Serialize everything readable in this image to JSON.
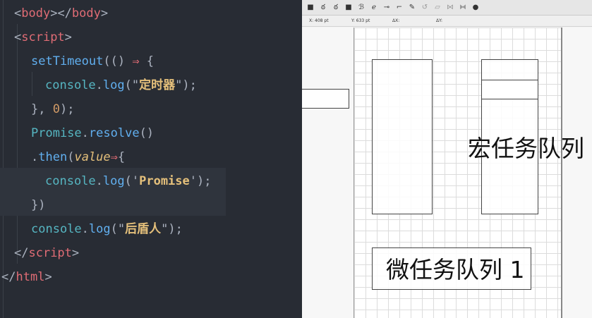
{
  "editor": {
    "lines": [
      {
        "tokens": [
          {
            "t": "<",
            "c": "punct"
          },
          {
            "t": "body",
            "c": "tag"
          },
          {
            "t": "></",
            "c": "punct"
          },
          {
            "t": "body",
            "c": "tag"
          },
          {
            "t": ">",
            "c": "punct"
          }
        ]
      },
      {
        "tokens": [
          {
            "t": "<",
            "c": "punct"
          },
          {
            "t": "script",
            "c": "tag"
          },
          {
            "t": ">",
            "c": "punct"
          }
        ]
      },
      {
        "tokens": [
          {
            "t": "setTimeout",
            "c": "fn"
          },
          {
            "t": "(() ",
            "c": "punct"
          },
          {
            "t": "⇒",
            "c": "arrow"
          },
          {
            "t": " {",
            "c": "punct"
          }
        ]
      },
      {
        "tokens": [
          {
            "t": "console",
            "c": "obj"
          },
          {
            "t": ".",
            "c": "punct"
          },
          {
            "t": "log",
            "c": "fn"
          },
          {
            "t": "(\"",
            "c": "punct"
          },
          {
            "t": "定时器",
            "c": "cn"
          },
          {
            "t": "\");",
            "c": "punct"
          }
        ]
      },
      {
        "tokens": [
          {
            "t": "}, ",
            "c": "punct"
          },
          {
            "t": "0",
            "c": "num"
          },
          {
            "t": ");",
            "c": "punct"
          }
        ]
      },
      {
        "tokens": [
          {
            "t": "Promise",
            "c": "obj"
          },
          {
            "t": ".",
            "c": "punct"
          },
          {
            "t": "resolve",
            "c": "fn"
          },
          {
            "t": "()",
            "c": "punct"
          }
        ]
      },
      {
        "tokens": [
          {
            "t": ".",
            "c": "punct"
          },
          {
            "t": "then",
            "c": "fn"
          },
          {
            "t": "(",
            "c": "punct"
          },
          {
            "t": "value",
            "c": "param"
          },
          {
            "t": "⇒",
            "c": "arrow"
          },
          {
            "t": "{",
            "c": "punct"
          }
        ]
      },
      {
        "tokens": [
          {
            "t": "console",
            "c": "obj"
          },
          {
            "t": ".",
            "c": "punct"
          },
          {
            "t": "log",
            "c": "fn"
          },
          {
            "t": "('",
            "c": "punct"
          },
          {
            "t": "Promise",
            "c": "cn"
          },
          {
            "t": "');",
            "c": "punct"
          }
        ]
      },
      {
        "tokens": [
          {
            "t": "})",
            "c": "punct"
          }
        ]
      },
      {
        "tokens": [
          {
            "t": "console",
            "c": "obj"
          },
          {
            "t": ".",
            "c": "punct"
          },
          {
            "t": "log",
            "c": "fn"
          },
          {
            "t": "(\"",
            "c": "punct"
          },
          {
            "t": "后盾人",
            "c": "cn"
          },
          {
            "t": "\");",
            "c": "punct"
          }
        ]
      },
      {
        "tokens": [
          {
            "t": "</",
            "c": "punct"
          },
          {
            "t": "script",
            "c": "tag"
          },
          {
            "t": ">",
            "c": "punct"
          }
        ]
      },
      {
        "tokens": [
          {
            "t": "</",
            "c": "punct"
          },
          {
            "t": "html",
            "c": "tag"
          },
          {
            "t": ">",
            "c": "punct"
          }
        ]
      }
    ]
  },
  "drawing": {
    "toolbar_icons": [
      "select-tool-icon",
      "lasso-tool-icon",
      "lasso-subtract-icon",
      "rect-select-icon",
      "text-tool-icon",
      "brush-tool-icon",
      "connector-icon",
      "line-tool-icon",
      "pen-tool-icon",
      "undo-icon",
      "redo-icon",
      "flip-icon",
      "info-icon"
    ],
    "coords": {
      "x": "X:  408 pt",
      "y": "Y:  633 pt",
      "dx": "ΔX:",
      "dy": "ΔY:"
    },
    "macro_label": "宏任务队列",
    "micro_label": "微任务队列 1"
  }
}
